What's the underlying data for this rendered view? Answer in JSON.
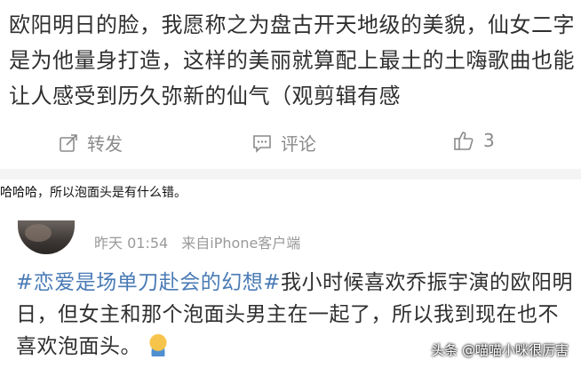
{
  "post1": {
    "text": "欧阳明日的脸，我愿称之为盘古开天地级的美貌，仙女二字是为他量身打造，这样的美丽就算配上最土的土嗨歌曲也能让人感受到历久弥新的仙气（观剪辑有感"
  },
  "actions": {
    "repost_label": "转发",
    "comment_label": "评论",
    "like_count": "3",
    "repost_icon": "share-icon",
    "comment_icon": "comment-icon",
    "like_icon": "thumbs-up-icon"
  },
  "caption": "哈哈哈，所以泡面头是有什么错。",
  "post2": {
    "time": "昨天 01:54",
    "source": "来自iPhone客户端",
    "hashtag": "#恋爱是场单刀赴会的幻想#",
    "text": "我小时候喜欢乔振宇演的欧阳明日，但女主和那个泡面头男主在一起了，所以我到现在也不喜欢泡面头。",
    "emoji": "crying-emoji"
  },
  "watermark": "头条 @喵喵小咪很厉害",
  "colors": {
    "hashtag": "#4a7bb5",
    "icon_gray": "#8a8a8a",
    "meta_gray": "#9a9a9a"
  }
}
